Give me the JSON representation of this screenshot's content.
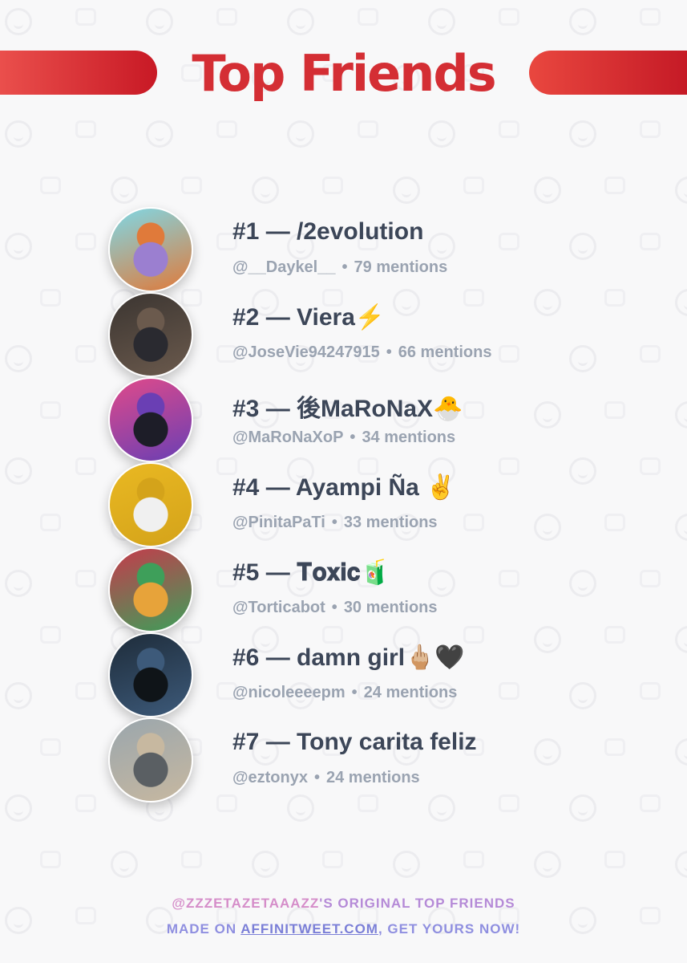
{
  "title": "Top Friends",
  "friends": [
    {
      "name": "#1 — /2evolution",
      "handle": "@__Daykel__",
      "mentions": "79 mentions"
    },
    {
      "name": "#2 — Viera⚡",
      "handle": "@JoseVie94247915",
      "mentions": "66 mentions"
    },
    {
      "name": "#3 — 後MaRoNaX🐣",
      "handle": "@MaRoNaXoP",
      "mentions": "34 mentions"
    },
    {
      "name": "#4 — Ayampi Ña ✌",
      "handle": "@PinitaPaTi",
      "mentions": "33 mentions"
    },
    {
      "name": "#5 — 𝐓𝐨𝐱𝐢𝐜🧃",
      "handle": "@Torticabot",
      "mentions": "30 mentions"
    },
    {
      "name": "#6 — damn girl🖕🏼🖤",
      "handle": "@nicoleeeepm",
      "mentions": "24 mentions"
    },
    {
      "name": "#7 — Tony carita feliz",
      "handle": "@eztonyx",
      "mentions": "24 mentions"
    }
  ],
  "separator": "•",
  "footer": {
    "handle": "@ZZZETAZETAAAZZ",
    "line1_rest": "'S ORIGINAL TOP FRIENDS",
    "line2_prefix": "MADE ON ",
    "link": "AFFINITWEET.COM",
    "line2_suffix": ", GET YOURS NOW!"
  },
  "colors": {
    "title": "#d42e34",
    "header_bar": "#c81925",
    "name_text": "#3c4658",
    "sub_text": "#9aa3b1",
    "footer_pink": "#d58dc9",
    "footer_purple": "#8f8fe0"
  },
  "avatar_palettes": [
    [
      "#7fd8e6",
      "#e07a3a",
      "#9b7fd0"
    ],
    [
      "#3b3531",
      "#6b5a4d",
      "#2a2a30"
    ],
    [
      "#e04a8a",
      "#6a3fb4",
      "#1d1d28"
    ],
    [
      "#e9b822",
      "#d4a31a",
      "#f0f0f0"
    ],
    [
      "#c53b4c",
      "#3e9f5a",
      "#e7a33a"
    ],
    [
      "#1e2c3a",
      "#3d5a7a",
      "#0f1418"
    ],
    [
      "#9aa6ad",
      "#c7b8a0",
      "#5a5f63"
    ]
  ]
}
